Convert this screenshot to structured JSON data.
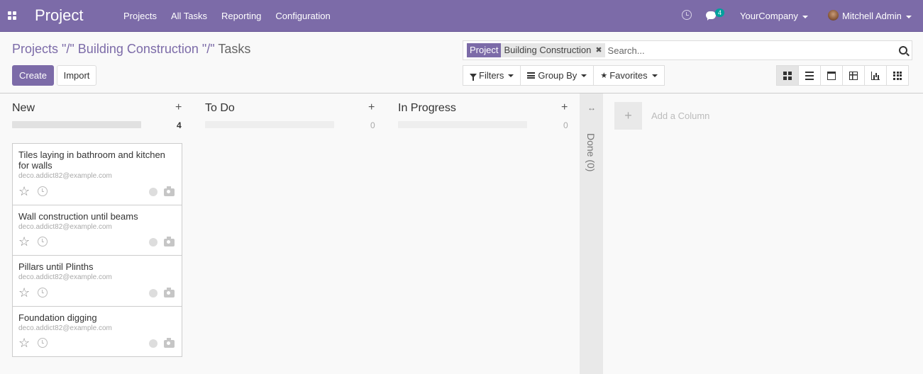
{
  "navbar": {
    "app_title": "Project",
    "menu": [
      "Projects",
      "All Tasks",
      "Reporting",
      "Configuration"
    ],
    "messages_badge": "4",
    "company": "YourCompany",
    "user": "Mitchell Admin"
  },
  "breadcrumb": {
    "parent": "Projects \"/\" Building Construction \"/\"",
    "current": "Tasks"
  },
  "buttons": {
    "create": "Create",
    "import": "Import"
  },
  "search": {
    "facet_label": "Project",
    "facet_value": "Building Construction",
    "placeholder": "Search..."
  },
  "filters": {
    "filters": "Filters",
    "group_by": "Group By",
    "favorites": "Favorites"
  },
  "views": [
    "kanban",
    "list",
    "calendar",
    "pivot",
    "graph",
    "grid"
  ],
  "columns": [
    {
      "title": "New",
      "count": "4"
    },
    {
      "title": "To Do",
      "count": "0"
    },
    {
      "title": "In Progress",
      "count": "0"
    }
  ],
  "folded_column": {
    "title": "Done (0)",
    "arrows": "↔"
  },
  "cards": [
    {
      "title": "Tiles laying in bathroom and kitchen for walls",
      "email": "deco.addict82@example.com"
    },
    {
      "title": "Wall construction until beams",
      "email": "deco.addict82@example.com"
    },
    {
      "title": "Pillars until Plinths",
      "email": "deco.addict82@example.com"
    },
    {
      "title": "Foundation digging",
      "email": "deco.addict82@example.com"
    }
  ],
  "add_column": {
    "label": "Add a Column",
    "plus": "+"
  },
  "colors": {
    "brand": "#7c6ba8",
    "badge": "#00a09d"
  }
}
